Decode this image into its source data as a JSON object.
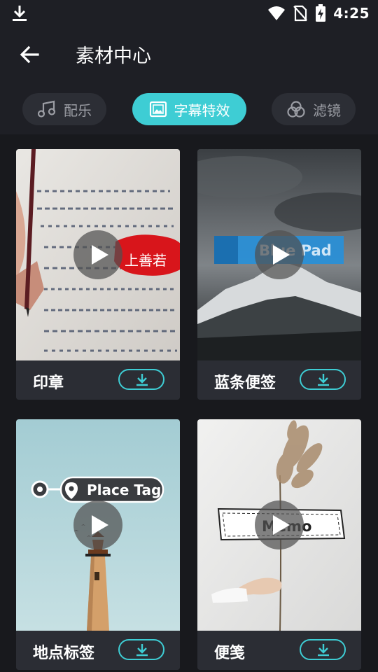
{
  "status_bar": {
    "time": "4:25",
    "icons": [
      "download-icon",
      "wifi-icon",
      "no-sim-icon",
      "battery-charging-icon"
    ]
  },
  "app_bar": {
    "back_icon": "arrow-left-icon",
    "title": "素材中心"
  },
  "tabs": [
    {
      "label": "配乐",
      "icon": "music-note-icon",
      "active": false
    },
    {
      "label": "字幕特效",
      "icon": "image-frame-icon",
      "active": true
    },
    {
      "label": "滤镜",
      "icon": "filter-circles-icon",
      "active": false
    }
  ],
  "cards": [
    {
      "label": "印章",
      "overlay_text": "上善若",
      "thumbnail": "calligraphy-with-red-seal"
    },
    {
      "label": "蓝条便签",
      "overlay_text": "Blue Pad",
      "thumbnail": "snowy-mountain-under-clouds"
    },
    {
      "label": "地点标签",
      "overlay_text": "Place Tag",
      "thumbnail": "lighthouse-with-birds"
    },
    {
      "label": "便笺",
      "overlay_text": "Memo",
      "thumbnail": "pampas-grass-in-hand"
    }
  ],
  "colors": {
    "accent": "#3ecdd4",
    "background": "#18191d",
    "bar": "#1e1f25",
    "card": "#2b2d34",
    "seal_red": "#d8151b",
    "blue_pad": "#2a8fd6"
  }
}
